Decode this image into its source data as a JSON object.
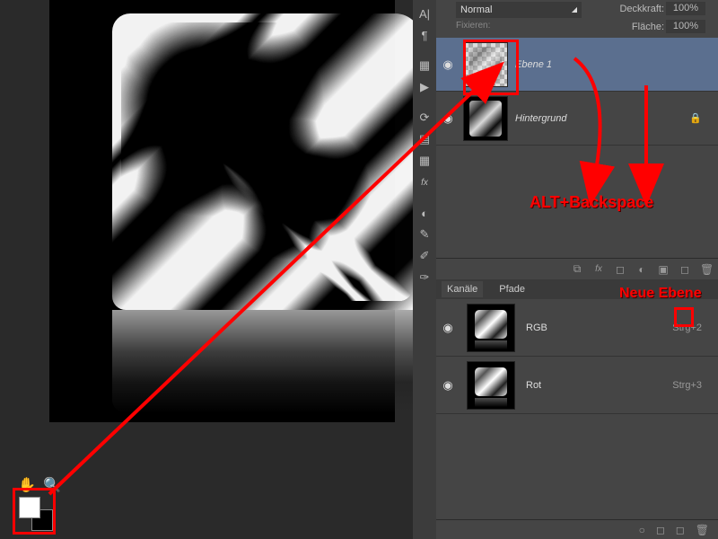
{
  "annotations": {
    "alt_backspace": "ALT+Backspace",
    "neue_ebene": "Neue Ebene"
  },
  "layers_panel": {
    "blend_mode": "Normal",
    "opacity_label": "Deckkraft:",
    "opacity_value": "100%",
    "fill_label": "Fläche:",
    "fill_value": "100%",
    "lock_label": "Fixieren:"
  },
  "layers": [
    {
      "name": "Ebene 1",
      "visible": "◉",
      "locked": ""
    },
    {
      "name": "Hintergrund",
      "visible": "◉",
      "locked": "🔒"
    }
  ],
  "tabs": {
    "channels": "Kanäle",
    "paths": "Pfade"
  },
  "channels": [
    {
      "name": "RGB",
      "shortcut": "Strg+2"
    },
    {
      "name": "Rot",
      "shortcut": "Strg+3"
    }
  ],
  "icons": {
    "hand": "✋",
    "zoom": "🔍",
    "text_a": "A|",
    "paragraph": "¶",
    "swatches": "▦",
    "play": "▶",
    "history": "⟳",
    "measure": "▤",
    "grid": "▦",
    "fx": "fx",
    "adjust": "◐",
    "brush1": "✎",
    "brush2": "✐",
    "brushset": "✑",
    "link": "⧉",
    "mask": "◻",
    "adjust_circle": "◐",
    "folder": "▣",
    "new_layer": "◻",
    "trash": "🗑",
    "sel_circle": "○",
    "new_ch": "◻",
    "dropdown": "◢"
  }
}
